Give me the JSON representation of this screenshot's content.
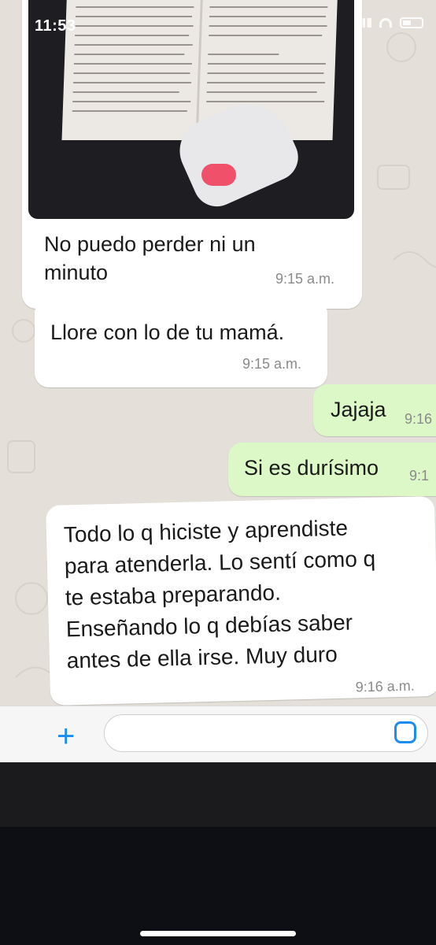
{
  "status_bar": {
    "time": "11:53"
  },
  "messages": [
    {
      "id": "img",
      "direction": "incoming",
      "type": "image",
      "text": "No puedo perder ni un minuto",
      "text_line1": "No puedo perder ni un",
      "text_line2": "minuto",
      "time": "9:15 a.m."
    },
    {
      "id": "m2",
      "direction": "incoming",
      "text": "Llore con lo de tu mamá.",
      "time": "9:15 a.m."
    },
    {
      "id": "m3",
      "direction": "outgoing",
      "text": "Jajaja",
      "time": "9:16"
    },
    {
      "id": "m4",
      "direction": "outgoing",
      "text": "Si es durísimo",
      "time": "9:1"
    },
    {
      "id": "m5",
      "direction": "incoming",
      "lines": [
        "Todo lo q hiciste y aprendiste",
        "para atenderla. Lo sentí como q",
        "te estaba preparando.",
        "Enseñando lo q debías saber",
        "antes de ella irse. Muy duro"
      ],
      "time": "9:16 a.m."
    }
  ],
  "composer": {
    "attach_icon": "plus-icon",
    "sticker_icon": "sticker-icon",
    "input_value": ""
  },
  "colors": {
    "incoming_bubble": "#ffffff",
    "outgoing_bubble": "#dcf8c6",
    "accent": "#1a8ef0",
    "chat_bg": "#e4e0d9"
  }
}
